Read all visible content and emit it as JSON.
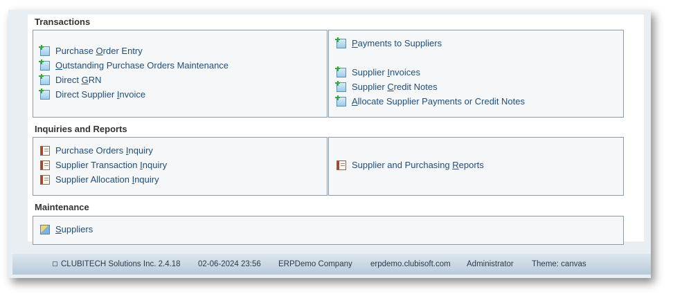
{
  "sections": {
    "transactions": {
      "title": "Transactions",
      "left": [
        {
          "pre": "Purchase ",
          "key": "O",
          "post": "rder Entry"
        },
        {
          "pre": "",
          "key": "O",
          "post": "utstanding Purchase Orders Maintenance"
        },
        {
          "pre": "Direct ",
          "key": "G",
          "post": "RN"
        },
        {
          "pre": "Direct Supplier ",
          "key": "I",
          "post": "nvoice"
        }
      ],
      "right_top": {
        "pre": "",
        "key": "P",
        "post": "ayments to Suppliers"
      },
      "right": [
        {
          "pre": "Supplier ",
          "key": "I",
          "post": "nvoices"
        },
        {
          "pre": "Supplier ",
          "key": "C",
          "post": "redit Notes"
        },
        {
          "pre": "",
          "key": "A",
          "post": "llocate Supplier Payments or Credit Notes"
        }
      ]
    },
    "inquiries": {
      "title": "Inquiries and Reports",
      "left": [
        {
          "pre": "Purchase Orders ",
          "key": "I",
          "post": "nquiry"
        },
        {
          "pre": "Supplier Transaction ",
          "key": "I",
          "post": "nquiry"
        },
        {
          "pre": "Supplier Allocation ",
          "key": "I",
          "post": "nquiry"
        }
      ],
      "right": [
        {
          "pre": "Supplier and Purchasing ",
          "key": "R",
          "post": "eports"
        }
      ]
    },
    "maintenance": {
      "title": "Maintenance",
      "items": [
        {
          "pre": "",
          "key": "S",
          "post": "uppliers"
        }
      ]
    }
  },
  "footer": {
    "version": "CLUBITECH Solutions Inc. 2.4.18",
    "datetime": "02-06-2024 23:56",
    "company": "ERPDemo Company",
    "host": "erpdemo.clubisoft.com",
    "user": "Administrator",
    "theme": "Theme: canvas"
  },
  "icons": {
    "transaction": "add-document-icon",
    "report": "report-book-icon",
    "maintenance": "edit-document-icon"
  },
  "colors": {
    "link": "#1f4e79",
    "panel_border": "#8c9aa6",
    "footer_gradient_top": "#dde7ef",
    "footer_gradient_bottom": "#b7cad9"
  }
}
